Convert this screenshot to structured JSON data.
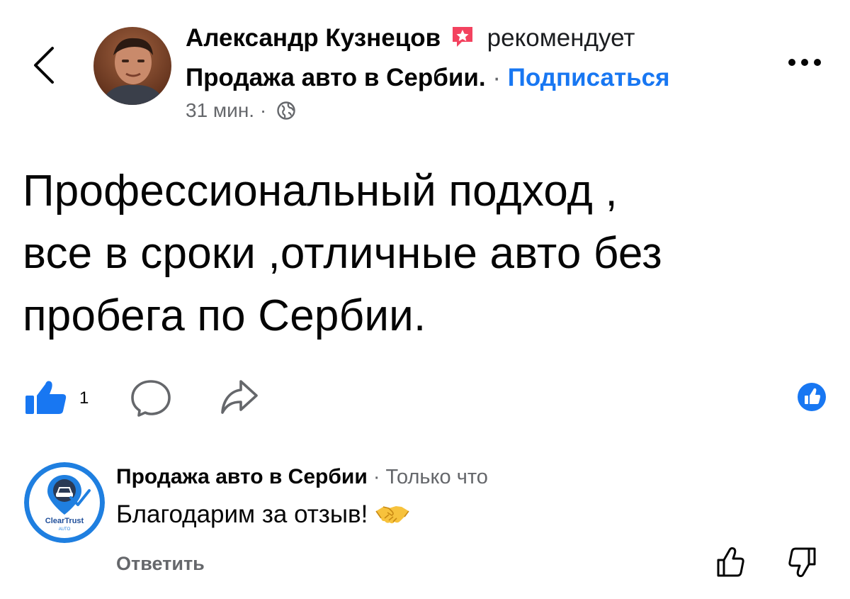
{
  "header": {
    "author_name": "Александр Кузнецов",
    "recommends_text": "рекомендует",
    "page_name": "Продажа авто в Сербии.",
    "separator": " · ",
    "subscribe_label": "Подписаться",
    "time": "31 мин.",
    "meta_separator": " · ",
    "back_icon": "chevron-left-icon",
    "more_icon": "more-horizontal-icon",
    "privacy_icon": "globe-icon"
  },
  "post": {
    "text_line1": "Профессиональный подход ,",
    "text_line2": "все в сроки ,отличные авто без",
    "text_line3": "пробега по Сербии."
  },
  "actions": {
    "like_count": "1",
    "like_icon": "thumbs-up-icon",
    "comment_icon": "comment-icon",
    "share_icon": "share-icon"
  },
  "comment": {
    "author": "Продажа авто в Сербии",
    "separator": " · ",
    "time": "Только что",
    "text": "Благодарим за отзыв!",
    "reply_label": "Ответить",
    "avatar_brand": "ClearTrust",
    "avatar_sub": "AUTO"
  },
  "colors": {
    "accent": "#1877f2",
    "muted": "#65676b",
    "text": "#050505",
    "recommend_badge": "#f3425f",
    "cleartrust_blue": "#1f7fe0"
  }
}
